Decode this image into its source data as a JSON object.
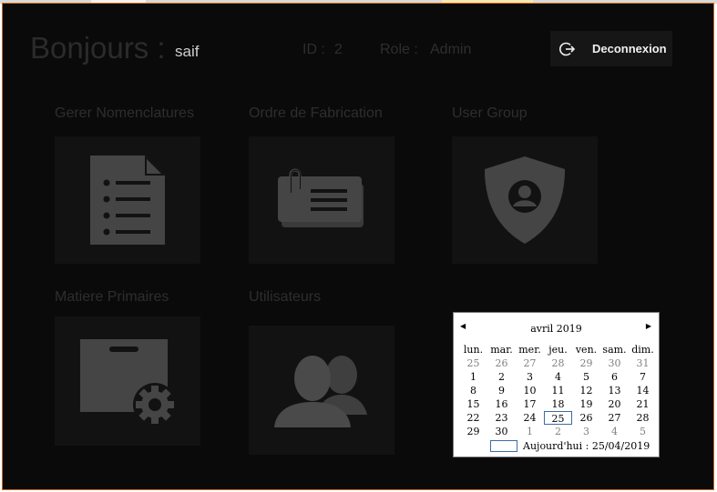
{
  "header": {
    "greeting": "Bonjours :",
    "username": "saif",
    "id_label": "ID :",
    "id_value": "2",
    "role_label": "Role :",
    "role_value": "Admin",
    "logout_label": "Deconnexion"
  },
  "tiles": [
    {
      "label": "Gerer Nomenclatures",
      "icon": "document-list-icon"
    },
    {
      "label": "Ordre de Fabrication",
      "icon": "cards-clip-icon"
    },
    {
      "label": "User Group",
      "icon": "shield-user-icon"
    },
    {
      "label": "Matiere Primaires",
      "icon": "box-gear-icon"
    },
    {
      "label": "Utilisateurs",
      "icon": "users-icon"
    }
  ],
  "calendar": {
    "prev": "◀",
    "next": "▶",
    "title": "avril 2019",
    "weekdays": [
      "lun.",
      "mar.",
      "mer.",
      "jeu.",
      "ven.",
      "sam.",
      "dim."
    ],
    "weeks": [
      [
        "25",
        "26",
        "27",
        "28",
        "29",
        "30",
        "31"
      ],
      [
        "1",
        "2",
        "3",
        "4",
        "5",
        "6",
        "7"
      ],
      [
        "8",
        "9",
        "10",
        "11",
        "12",
        "13",
        "14"
      ],
      [
        "15",
        "16",
        "17",
        "18",
        "19",
        "20",
        "21"
      ],
      [
        "22",
        "23",
        "24",
        "25",
        "26",
        "27",
        "28"
      ],
      [
        "29",
        "30",
        "1",
        "2",
        "3",
        "4",
        "5"
      ]
    ],
    "selected": "25",
    "today_label": "Aujourd'hui : 25/04/2019"
  }
}
